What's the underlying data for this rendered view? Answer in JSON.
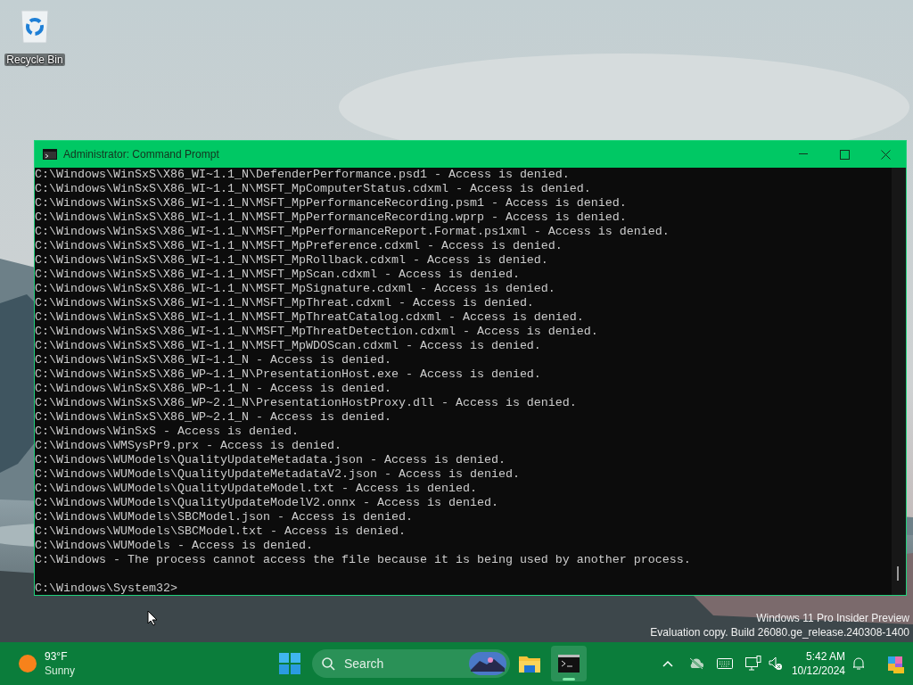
{
  "desktop_icons": [
    {
      "label": "Recycle Bin"
    }
  ],
  "window": {
    "title": "Administrator: Command Prompt",
    "lines": [
      "C:\\Windows\\WinSxS\\X86_WI~1.1_N\\DefenderPerformance.psd1 - Access is denied.",
      "C:\\Windows\\WinSxS\\X86_WI~1.1_N\\MSFT_MpComputerStatus.cdxml - Access is denied.",
      "C:\\Windows\\WinSxS\\X86_WI~1.1_N\\MSFT_MpPerformanceRecording.psm1 - Access is denied.",
      "C:\\Windows\\WinSxS\\X86_WI~1.1_N\\MSFT_MpPerformanceRecording.wprp - Access is denied.",
      "C:\\Windows\\WinSxS\\X86_WI~1.1_N\\MSFT_MpPerformanceReport.Format.ps1xml - Access is denied.",
      "C:\\Windows\\WinSxS\\X86_WI~1.1_N\\MSFT_MpPreference.cdxml - Access is denied.",
      "C:\\Windows\\WinSxS\\X86_WI~1.1_N\\MSFT_MpRollback.cdxml - Access is denied.",
      "C:\\Windows\\WinSxS\\X86_WI~1.1_N\\MSFT_MpScan.cdxml - Access is denied.",
      "C:\\Windows\\WinSxS\\X86_WI~1.1_N\\MSFT_MpSignature.cdxml - Access is denied.",
      "C:\\Windows\\WinSxS\\X86_WI~1.1_N\\MSFT_MpThreat.cdxml - Access is denied.",
      "C:\\Windows\\WinSxS\\X86_WI~1.1_N\\MSFT_MpThreatCatalog.cdxml - Access is denied.",
      "C:\\Windows\\WinSxS\\X86_WI~1.1_N\\MSFT_MpThreatDetection.cdxml - Access is denied.",
      "C:\\Windows\\WinSxS\\X86_WI~1.1_N\\MSFT_MpWDOScan.cdxml - Access is denied.",
      "C:\\Windows\\WinSxS\\X86_WI~1.1_N - Access is denied.",
      "C:\\Windows\\WinSxS\\X86_WP~1.1_N\\PresentationHost.exe - Access is denied.",
      "C:\\Windows\\WinSxS\\X86_WP~1.1_N - Access is denied.",
      "C:\\Windows\\WinSxS\\X86_WP~2.1_N\\PresentationHostProxy.dll - Access is denied.",
      "C:\\Windows\\WinSxS\\X86_WP~2.1_N - Access is denied.",
      "C:\\Windows\\WinSxS - Access is denied.",
      "C:\\Windows\\WMSysPr9.prx - Access is denied.",
      "C:\\Windows\\WUModels\\QualityUpdateMetadata.json - Access is denied.",
      "C:\\Windows\\WUModels\\QualityUpdateMetadataV2.json - Access is denied.",
      "C:\\Windows\\WUModels\\QualityUpdateModel.txt - Access is denied.",
      "C:\\Windows\\WUModels\\QualityUpdateModelV2.onnx - Access is denied.",
      "C:\\Windows\\WUModels\\SBCModel.json - Access is denied.",
      "C:\\Windows\\WUModels\\SBCModel.txt - Access is denied.",
      "C:\\Windows\\WUModels - Access is denied.",
      "C:\\Windows - The process cannot access the file because it is being used by another process."
    ],
    "prompt": "C:\\Windows\\System32>"
  },
  "watermark": [
    "Windows 11 Pro Insider Preview",
    "Evaluation copy. Build 26080.ge_release.240308-1400"
  ],
  "taskbar": {
    "weather": {
      "temperature": "93°F",
      "condition": "Sunny"
    },
    "search": {
      "placeholder": "Search"
    },
    "apps": [
      {
        "kind": "folder",
        "active": false
      },
      {
        "kind": "terminal",
        "active": true
      }
    ],
    "clock": {
      "time": "5:42 AM",
      "date": "10/12/2024"
    }
  }
}
